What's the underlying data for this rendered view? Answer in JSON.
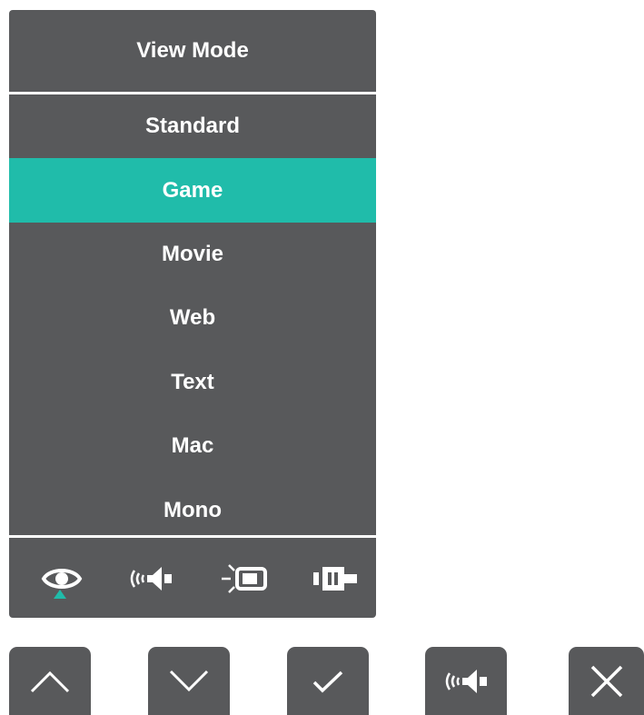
{
  "osd": {
    "title": "View Mode",
    "items": [
      {
        "label": "Standard",
        "selected": false
      },
      {
        "label": "Game",
        "selected": true
      },
      {
        "label": "Movie",
        "selected": false
      },
      {
        "label": "Web",
        "selected": false
      },
      {
        "label": "Text",
        "selected": false
      },
      {
        "label": "Mac",
        "selected": false
      },
      {
        "label": "Mono",
        "selected": false
      }
    ],
    "tabs": [
      {
        "icon": "eye-icon",
        "active": true
      },
      {
        "icon": "speaker-icon",
        "active": false
      },
      {
        "icon": "backlight-icon",
        "active": false
      },
      {
        "icon": "input-connector-icon",
        "active": false
      }
    ]
  },
  "buttons": [
    {
      "icon": "chevron-up-icon"
    },
    {
      "icon": "chevron-down-icon"
    },
    {
      "icon": "checkmark-icon"
    },
    {
      "icon": "speaker-icon"
    },
    {
      "icon": "close-icon"
    }
  ],
  "colors": {
    "panel": "#58595b",
    "accent": "#20bcaa",
    "text": "#ffffff"
  }
}
